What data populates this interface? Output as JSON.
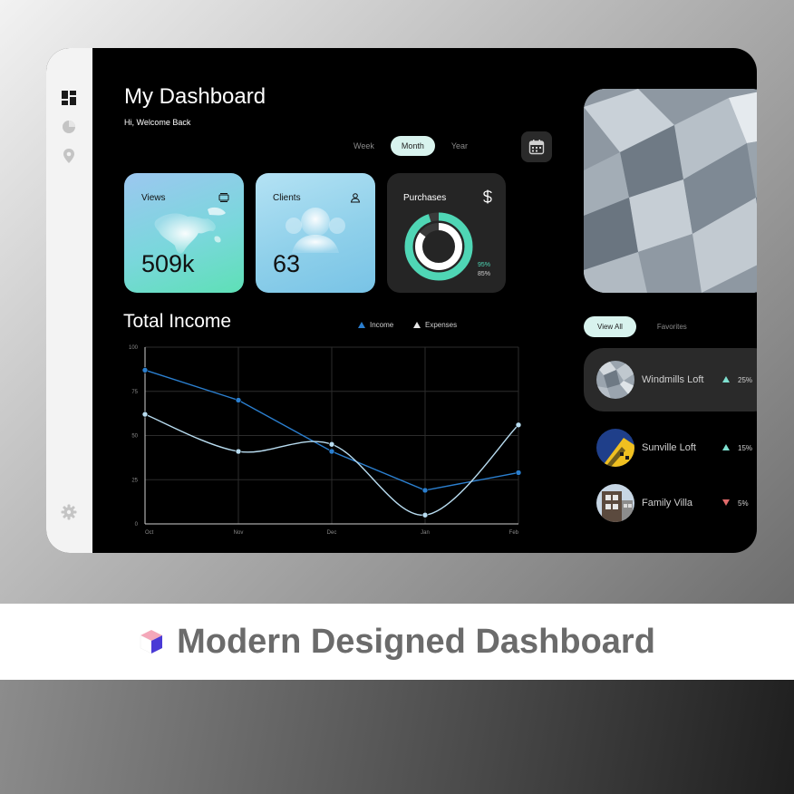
{
  "sidebar": {
    "items": [
      {
        "icon": "dashboard-grid-icon"
      },
      {
        "icon": "pie-chart-icon"
      },
      {
        "icon": "location-pin-icon"
      }
    ],
    "settings_icon": "gear-icon"
  },
  "header": {
    "title": "My Dashboard",
    "subtitle": "Hi, Welcome Back"
  },
  "period_filter": {
    "options": [
      "Week",
      "Month",
      "Year"
    ],
    "selected": "Month",
    "calendar_icon": "calendar-icon"
  },
  "cards": {
    "views": {
      "label": "Views",
      "value": "509k",
      "icon": "layers-icon"
    },
    "clients": {
      "label": "Clients",
      "value": "63",
      "icon": "user-icon"
    },
    "purchases": {
      "label": "Purchases",
      "icon": "dollar-icon",
      "pct_primary": "95%",
      "pct_secondary": "85%",
      "ring_primary": 0.95,
      "ring_secondary": 0.85
    }
  },
  "income": {
    "title": "Total Income",
    "legend": [
      "Income",
      "Expenses"
    ]
  },
  "chart_data": {
    "type": "line",
    "categories": [
      "Oct",
      "Nov",
      "Dec",
      "Jan",
      "Feb"
    ],
    "y_ticks": [
      "100",
      "75",
      "50",
      "25",
      "0"
    ],
    "ylim": [
      0,
      100
    ],
    "grid": true,
    "legend_position": "top-right",
    "series": [
      {
        "name": "Income",
        "color": "#2b7fcf",
        "values": [
          87,
          70,
          41,
          19,
          29
        ]
      },
      {
        "name": "Expenses",
        "color": "#b8dcf0",
        "values": [
          62,
          41,
          45,
          5,
          56
        ]
      }
    ]
  },
  "listing_tabs": {
    "view_all": "View All",
    "favorites": "Favorites"
  },
  "listings": [
    {
      "name": "Windmills Loft",
      "pct": "25%",
      "trend": "up",
      "highlight": true
    },
    {
      "name": "Sunville Loft",
      "pct": "15%",
      "trend": "up",
      "highlight": false
    },
    {
      "name": "Family Villa",
      "pct": "5%",
      "trend": "down",
      "highlight": false
    }
  ],
  "colors": {
    "accent_mint": "#4fd6b5",
    "up": "#7fe0d0",
    "down": "#e06a6a"
  },
  "banner": {
    "title": "Modern Designed Dashboard"
  }
}
